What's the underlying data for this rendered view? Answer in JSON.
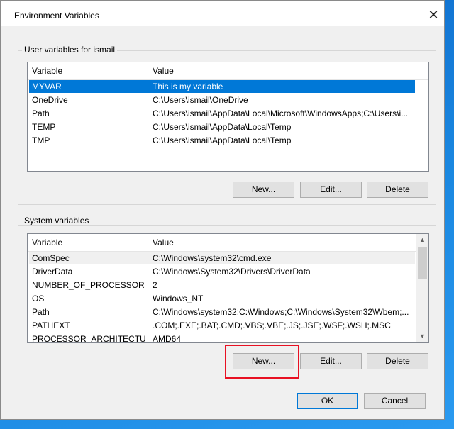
{
  "dialog": {
    "title": "Environment Variables",
    "close_glyph": "✕"
  },
  "user_vars": {
    "group_label": "User variables for ismail",
    "columns": [
      "Variable",
      "Value"
    ],
    "rows": [
      {
        "name": "MYVAR",
        "value": "This is my variable",
        "selected": true
      },
      {
        "name": "OneDrive",
        "value": "C:\\Users\\ismail\\OneDrive"
      },
      {
        "name": "Path",
        "value": "C:\\Users\\ismail\\AppData\\Local\\Microsoft\\WindowsApps;C:\\Users\\i..."
      },
      {
        "name": "TEMP",
        "value": "C:\\Users\\ismail\\AppData\\Local\\Temp"
      },
      {
        "name": "TMP",
        "value": "C:\\Users\\ismail\\AppData\\Local\\Temp"
      }
    ],
    "buttons": {
      "new": "New...",
      "edit": "Edit...",
      "delete": "Delete"
    }
  },
  "system_vars": {
    "group_label": "System variables",
    "columns": [
      "Variable",
      "Value"
    ],
    "rows": [
      {
        "name": "ComSpec",
        "value": "C:\\Windows\\system32\\cmd.exe",
        "focused": true
      },
      {
        "name": "DriverData",
        "value": "C:\\Windows\\System32\\Drivers\\DriverData"
      },
      {
        "name": "NUMBER_OF_PROCESSORS",
        "value": "2"
      },
      {
        "name": "OS",
        "value": "Windows_NT"
      },
      {
        "name": "Path",
        "value": "C:\\Windows\\system32;C:\\Windows;C:\\Windows\\System32\\Wbem;..."
      },
      {
        "name": "PATHEXT",
        "value": ".COM;.EXE;.BAT;.CMD;.VBS;.VBE;.JS;.JSE;.WSF;.WSH;.MSC"
      },
      {
        "name": "PROCESSOR_ARCHITECTURE",
        "value": "AMD64"
      }
    ],
    "buttons": {
      "new": "New...",
      "edit": "Edit...",
      "delete": "Delete"
    }
  },
  "footer": {
    "ok": "OK",
    "cancel": "Cancel"
  },
  "icons": {
    "scroll_up": "up-arrow-icon",
    "scroll_down": "down-arrow-icon"
  },
  "colors": {
    "selection": "#0078d7",
    "highlight": "#e81123"
  }
}
